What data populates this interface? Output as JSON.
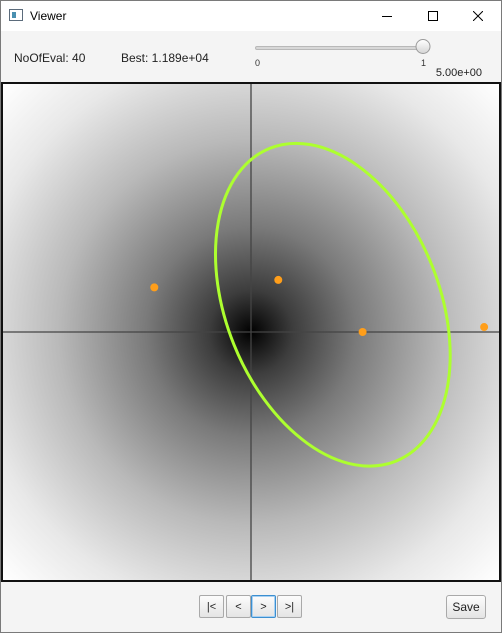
{
  "window": {
    "title": "Viewer",
    "controls": {
      "minimize": "minimize-icon",
      "maximize": "maximize-icon",
      "close": "close-icon"
    }
  },
  "stats": {
    "evals_text": "NoOfEval: 40",
    "best_text": "Best:  1.189e+04"
  },
  "slider": {
    "min_label": "0",
    "max_label": "1",
    "value": 1.0,
    "value_display": "5.00e+00"
  },
  "plot": {
    "x_range": [
      -1,
      1
    ],
    "y_range": [
      -1,
      1
    ],
    "axis_color": "#444444",
    "ellipse_color": "#adff2f",
    "point_color": "#ff9e1a",
    "ellipse": {
      "cx": 0.33,
      "cy": 0.11,
      "rx": 0.43,
      "ry": 0.68,
      "rotation_deg": -22
    },
    "points": [
      {
        "x": -0.39,
        "y": 0.18
      },
      {
        "x": 0.11,
        "y": 0.21
      },
      {
        "x": 0.45,
        "y": 0.0
      },
      {
        "x": 0.94,
        "y": 0.02
      }
    ]
  },
  "navigation": {
    "first_label": "|<",
    "prev_label": "<",
    "next_label": ">",
    "last_label": ">|"
  },
  "actions": {
    "save_label": "Save"
  }
}
